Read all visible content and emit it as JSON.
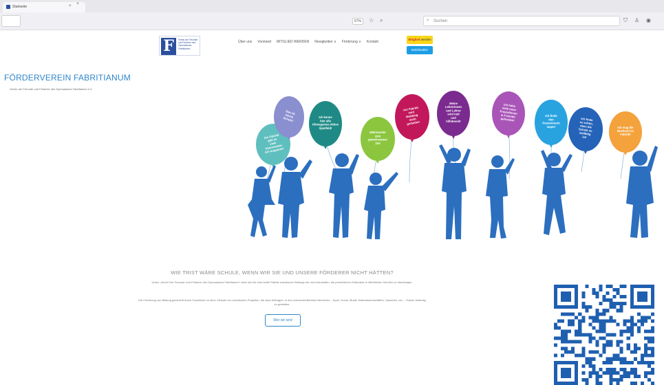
{
  "browser": {
    "tab_title": "Startseite",
    "tab_close": "×",
    "tab_new": "+",
    "zoom": "67%",
    "search_placeholder": "Suchen"
  },
  "site": {
    "logo_letter": "F",
    "logo_text": "Verein der Freunde und Förderer des Gymnasiums Fabritianum",
    "title": "FÖRDERVEREIN FABRITIANUM",
    "subtitle": "Verein der Freunde und Förderer des Gymnasiums Fabritianum e.V."
  },
  "nav": {
    "items": [
      "Über uns",
      "Vorstand",
      "MITGLIED WERDEN",
      "Neuigkeiten ∨",
      "Förderung ∨",
      "Kontakt"
    ],
    "mitglied_prefix": "Mitglied",
    "mitglied_label": "werden",
    "mk_label": "Mobilmakler"
  },
  "hero": {
    "balloons": [
      {
        "text": "Am Fabritti gibt es viele interessante AG-Angebote!",
        "color": "#5fbfbf"
      },
      {
        "text": "Das ist meine Schule!",
        "color": "#8a8fd0"
      },
      {
        "text": "Ich kenne hier alle Klimagartes-Aktive Spielfeld!",
        "color": "#1f8a85"
      },
      {
        "text": "Miteinander zum gemeinsamen Ziel",
        "color": "#8cc63f"
      },
      {
        "text": "Am Fabritti wird Mobbing nicht geduldet!",
        "color": "#c2185b"
      },
      {
        "text": "Meine Lehrerinnen und Lehrer sind nett und hilfsbereit!",
        "color": "#7b2b90"
      },
      {
        "text": "Ich habe viele neue Freundinnen & Freunde gefunden!",
        "color": "#a955b8"
      },
      {
        "text": "Ich finde den Pausenraum super!",
        "color": "#29a3e0"
      },
      {
        "text": "Ich finde es schön, dass die Schule so vielfältig ist!",
        "color": "#2463b8"
      },
      {
        "text": "Ich mag die Bücherei im Fabritti!",
        "color": "#f4a23c"
      }
    ]
  },
  "content": {
    "heading": "WIE TRIST WÄRE SCHULE, WENN WIR SIE UND UNSERE FÖRDERER NICHT HÄTTEN?",
    "paragraph1": "Unser „Verein Der Freunde Und Förderer des Gymnasiums Fabritianum“ setzt sich für eine breite Palette schulischer Belange ein und mitzuhelfen, die persönlichen Erlebnisse in öffentlichen Schulen zu übersteigen.",
    "paragraph2": "Die Förderung von Bildung geschieht durch Zuschüsse zu einer Vielzahl von schulischen Projekten, die dazu beitragen, in den unterschiedlichsten Bereichen – Sport, Kunst, Musik, Naturwissenschaften, Sprachen, etc. – Schule lebendig zu gestalten.",
    "button_label": "Wer wir sind"
  },
  "colors": {
    "brand_blue": "#2b4f9e",
    "title_blue": "#2e86c9",
    "yellow": "#f8d61a",
    "silhouette": "#2c6fbf"
  }
}
